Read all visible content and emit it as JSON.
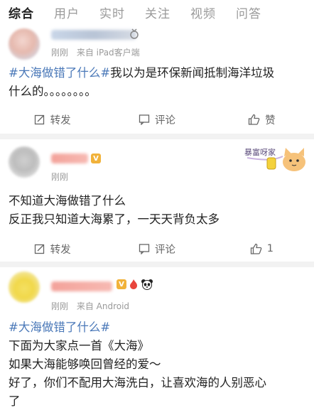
{
  "tabs": [
    "综合",
    "用户",
    "实时",
    "关注",
    "视频",
    "问答"
  ],
  "actions": {
    "repost": "转发",
    "comment": "评论",
    "like": "赞"
  },
  "posts": [
    {
      "time": "刚刚",
      "source": "来自 iPad客户端",
      "hashtag": "#大海做错了什么#",
      "line1": "我以为是环保新闻抵制海洋垃圾",
      "line2": "什么的。。。。。。。。",
      "like_label": "赞"
    },
    {
      "time": "刚刚",
      "line1": "不知道大海做错了什么",
      "line2": "反正我只知道大海累了，一天天背负太多",
      "like_count": "1",
      "sticker_text": "暴富呀家"
    },
    {
      "time": "刚刚",
      "source": "来自 Android",
      "hashtag": "#大海做错了什么#",
      "line1": "下面为大家点一首《大海》",
      "line2": "如果大海能够唤回曾经的爱～",
      "line3": "好了，你们不配用大海洗白，让喜欢海的人别恶心",
      "line4": "了"
    }
  ],
  "colors": {
    "hashtag": "#4a78b8",
    "divider": "#f2f2f2",
    "meta": "#9a9a9a"
  }
}
